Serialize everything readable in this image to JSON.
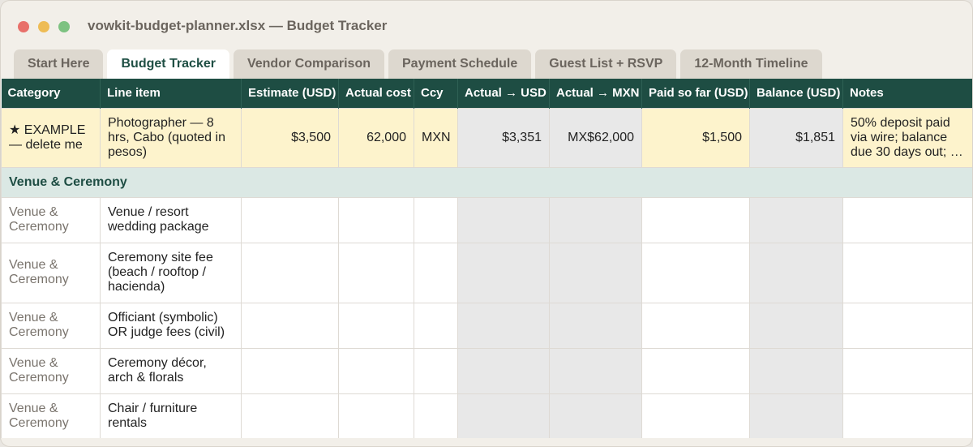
{
  "window": {
    "title": "vowkit-budget-planner.xlsx — Budget Tracker"
  },
  "tabs": [
    {
      "label": "Start Here"
    },
    {
      "label": "Budget Tracker",
      "active": true
    },
    {
      "label": "Vendor Comparison"
    },
    {
      "label": "Payment Schedule"
    },
    {
      "label": "Guest List + RSVP"
    },
    {
      "label": "12-Month Timeline"
    }
  ],
  "table": {
    "headers": [
      "Category",
      "Line item",
      "Estimate (USD)",
      "Actual cost",
      "Ccy",
      "Actual → USD",
      "Actual → MXN",
      "Paid so far (USD)",
      "Balance (USD)",
      "Notes"
    ],
    "example_row": {
      "category": "★ EXAMPLE — delete me",
      "line_item": "Photographer — 8 hrs, Cabo (quoted in pesos)",
      "estimate": "$3,500",
      "actual": "62,000",
      "ccy": "MXN",
      "actual_usd": "$3,351",
      "actual_mxn": "MX$62,000",
      "paid": "$1,500",
      "balance": "$1,851",
      "notes": "50% deposit paid via wire; balance due 30 days out; …"
    },
    "section_label": "Venue & Ceremony",
    "rows": [
      {
        "category": "Venue & Ceremony",
        "line_item": "Venue / resort wedding package"
      },
      {
        "category": "Venue & Ceremony",
        "line_item": "Ceremony site fee (beach / rooftop / hacienda)"
      },
      {
        "category": "Venue & Ceremony",
        "line_item": "Officiant (symbolic) OR judge fees (civil)"
      },
      {
        "category": "Venue & Ceremony",
        "line_item": "Ceremony décor, arch & florals"
      },
      {
        "category": "Venue & Ceremony",
        "line_item": "Chair / furniture rentals"
      }
    ]
  },
  "colors": {
    "header_bg": "#1e4d43",
    "example_bg": "#fdf3cc",
    "section_bg": "#dbe8e4",
    "formula_cell_bg": "#e8e8e8"
  }
}
